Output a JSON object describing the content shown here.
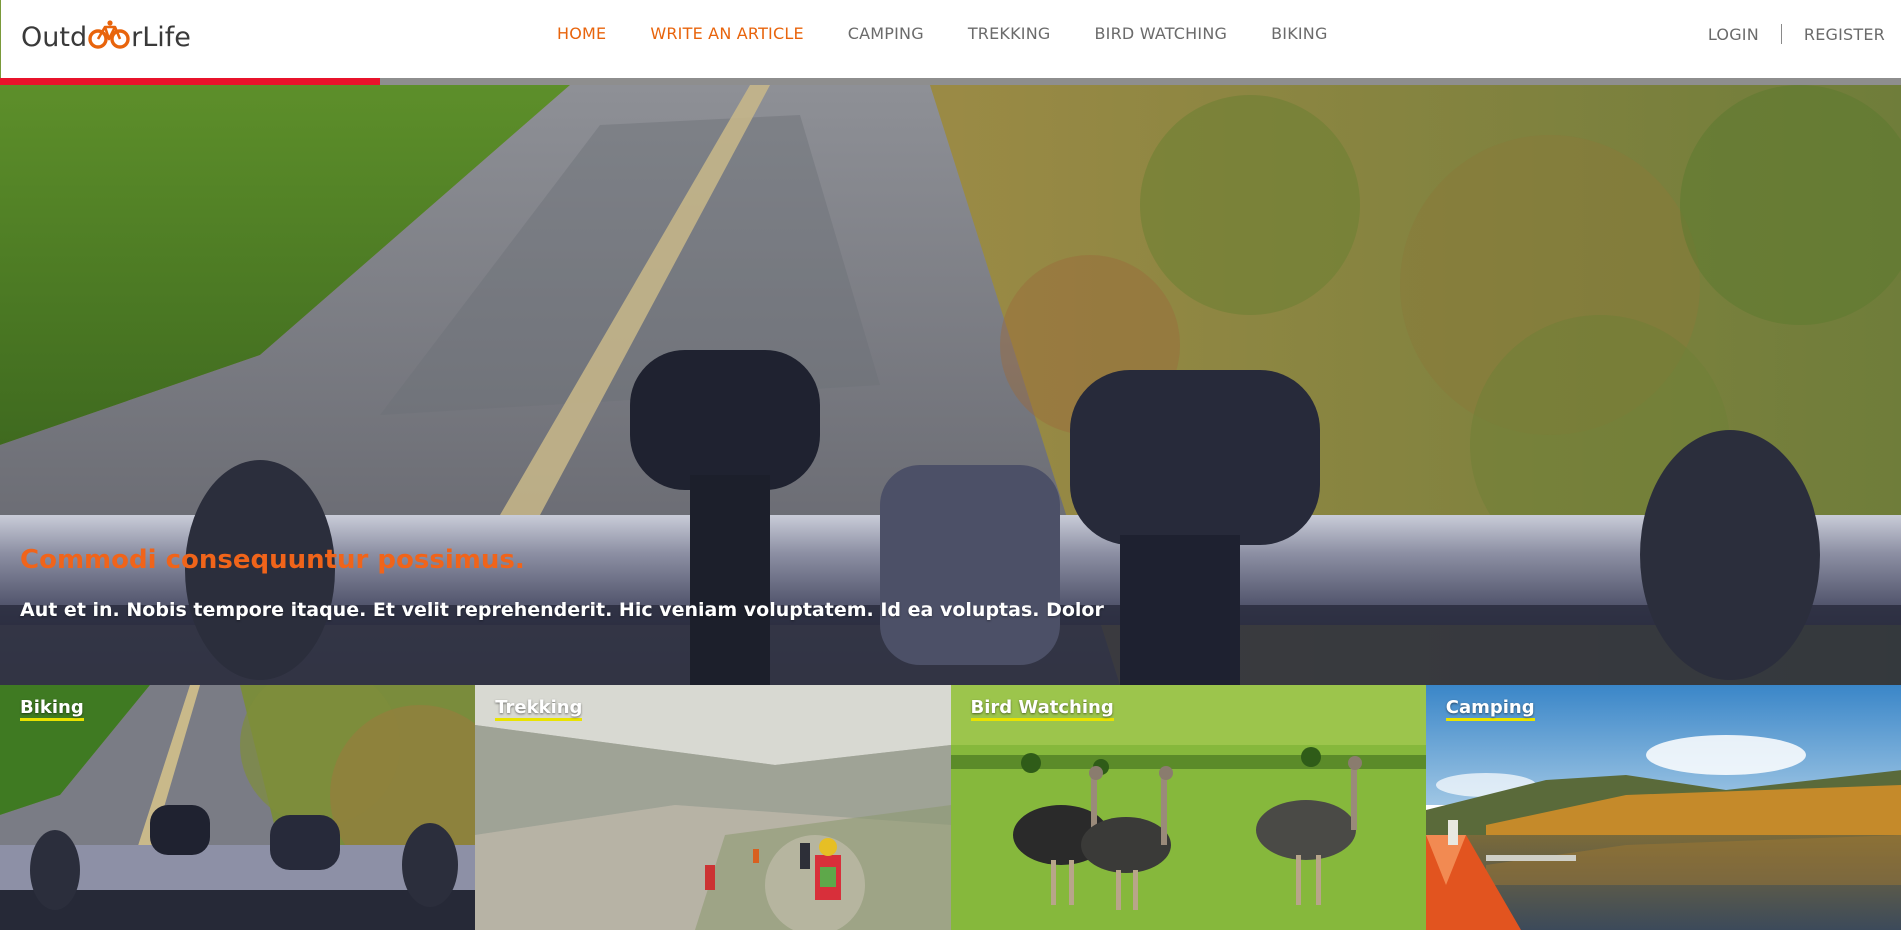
{
  "brand": {
    "name_part1": "Outd",
    "name_part2": "rLife",
    "icon": "bicycle-icon",
    "accent_color": "#e8640c"
  },
  "nav": {
    "items": [
      {
        "label": "HOME",
        "active": true
      },
      {
        "label": "WRITE AN ARTICLE",
        "active": true
      },
      {
        "label": "CAMPING",
        "active": false
      },
      {
        "label": "TREKKING",
        "active": false
      },
      {
        "label": "BIRD WATCHING",
        "active": false
      },
      {
        "label": "BIKING",
        "active": false
      }
    ]
  },
  "auth": {
    "login_label": "LOGIN",
    "register_label": "REGISTER"
  },
  "progress": {
    "fraction": 0.2,
    "fill_color": "#e8132b",
    "track_color": "#8e8e8e"
  },
  "hero": {
    "title": "Commodi consequuntur possimus.",
    "text": "Aut et in. Nobis tempore itaque. Et velit reprehenderit. Hic veniam voluptatem. Id ea voluptas. Dolor",
    "title_color": "#f0641a",
    "image": "bike-handlebar-road-photo"
  },
  "categories": [
    {
      "label": "Biking",
      "image": "bike-handlebar-road-photo"
    },
    {
      "label": "Trekking",
      "image": "mountain-hikers-photo"
    },
    {
      "label": "Bird Watching",
      "image": "ostriches-grassland-photo"
    },
    {
      "label": "Camping",
      "image": "lake-tent-photo"
    }
  ],
  "underline_color": "#e9e300"
}
